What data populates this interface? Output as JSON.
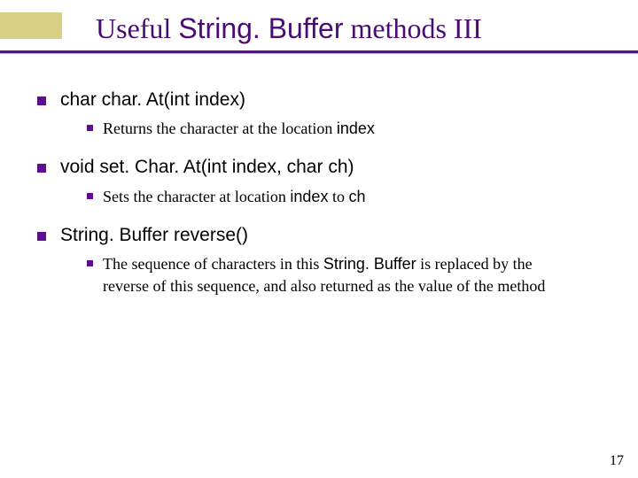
{
  "title": {
    "left": "Useful ",
    "code": "String. Buffer",
    "right": " methods III"
  },
  "items": [
    {
      "code": "char char. At(int index)",
      "desc": {
        "pre": "Returns the character at the location ",
        "mono": "index",
        "post": ""
      }
    },
    {
      "code": "void set. Char. At(int index, char ch)",
      "desc": {
        "pre": "Sets the character at location ",
        "mono": "index",
        "mid": " to ",
        "mono2": "ch",
        "post": ""
      }
    },
    {
      "code": "String. Buffer reverse()",
      "desc": {
        "pre": "The sequence of characters in this ",
        "mono": "String. Buffer",
        "post": " is replaced by the reverse of this sequence, and also returned as the value of the method"
      }
    }
  ],
  "page_number": "17"
}
